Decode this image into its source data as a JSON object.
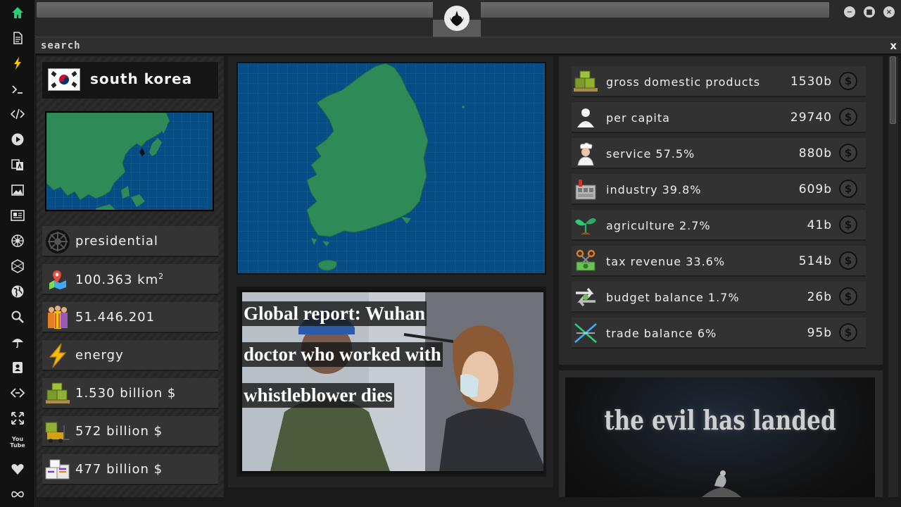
{
  "sidebar": {
    "icons": [
      "home-icon",
      "document-icon",
      "lightning-icon",
      "terminal-icon",
      "code-icon",
      "play-icon",
      "translate-icon",
      "image-icon",
      "news-icon",
      "empire-icon",
      "hexagon-icon",
      "globe-icon",
      "search-icon",
      "umbrella-icon",
      "contact-icon",
      "link-icon",
      "expand-icon",
      "youtube-icon",
      "heart-icon",
      "infinity-icon"
    ],
    "youtube_label": "You Tube"
  },
  "search": {
    "label": "search",
    "close": "x"
  },
  "country": {
    "name": "south korea",
    "government": "presidential",
    "area": "100.363 km",
    "area_exp": "2",
    "population": "51.446.201",
    "ministry": "energy",
    "gdp": "1.530 billion $",
    "industry_value": "572 billion $",
    "export_value": "477 billion $"
  },
  "news": {
    "headline_lines": [
      "Global report: Wuhan",
      "doctor who worked with",
      "whistleblower dies"
    ]
  },
  "stats": [
    {
      "icon": "crates-icon",
      "label": "gross domestic products",
      "value": "1530b"
    },
    {
      "icon": "person-icon",
      "label": "per capita",
      "value": "29740"
    },
    {
      "icon": "chef-icon",
      "label": "service 57.5%",
      "value": "880b"
    },
    {
      "icon": "factory-icon",
      "label": "industry 39.8%",
      "value": "609b"
    },
    {
      "icon": "sprout-icon",
      "label": "agriculture 2.7%",
      "value": "41b"
    },
    {
      "icon": "scissors-money-icon",
      "label": "tax revenue 33.6%",
      "value": "514b"
    },
    {
      "icon": "exchange-arrows-icon",
      "label": "budget balance 1.7%",
      "value": "26b"
    },
    {
      "icon": "trade-cross-icon",
      "label": "trade balance 6%",
      "value": "95b"
    }
  ],
  "coin_symbol": "$",
  "promo": {
    "title": "the evil has landed"
  },
  "colors": {
    "map_sea": "#074d85",
    "map_land": "#2e8b57",
    "accent_green": "#2ecc71"
  }
}
